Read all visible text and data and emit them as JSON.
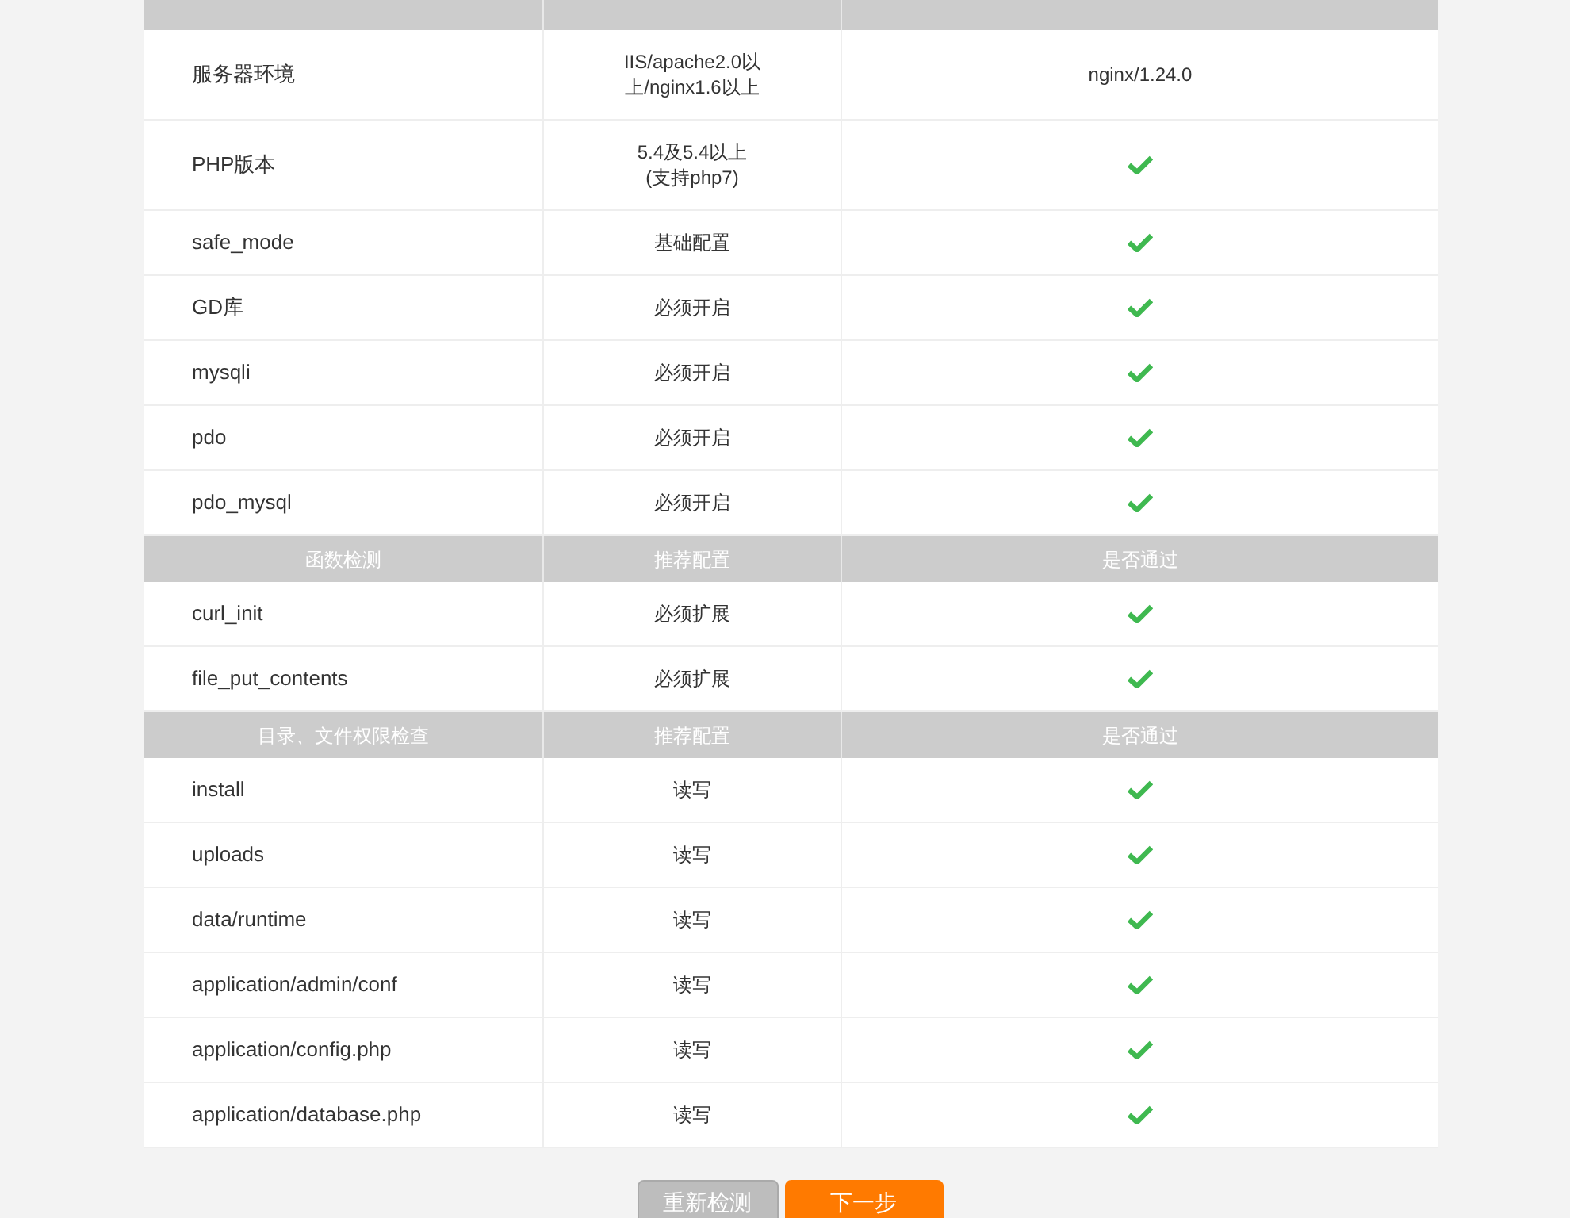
{
  "sections": [
    {
      "rows": [
        {
          "name": "服务器环境",
          "recommended": "IIS/apache2.0以上/nginx1.6以上",
          "status": {
            "kind": "text",
            "text": "nginx/1.24.0"
          }
        },
        {
          "name": "PHP版本",
          "recommended": "5.4及5.4以上\n(支持php7)",
          "status": {
            "kind": "check",
            "passed": true
          }
        },
        {
          "name": "safe_mode",
          "recommended": "基础配置",
          "status": {
            "kind": "check",
            "passed": true
          }
        },
        {
          "name": "GD库",
          "recommended": "必须开启",
          "status": {
            "kind": "check",
            "passed": true
          }
        },
        {
          "name": "mysqli",
          "recommended": "必须开启",
          "status": {
            "kind": "check",
            "passed": true
          }
        },
        {
          "name": "pdo",
          "recommended": "必须开启",
          "status": {
            "kind": "check",
            "passed": true
          }
        },
        {
          "name": "pdo_mysql",
          "recommended": "必须开启",
          "status": {
            "kind": "check",
            "passed": true
          }
        }
      ]
    },
    {
      "header": [
        "函数检测",
        "推荐配置",
        "是否通过"
      ],
      "rows": [
        {
          "name": "curl_init",
          "recommended": "必须扩展",
          "status": {
            "kind": "check",
            "passed": true
          }
        },
        {
          "name": "file_put_contents",
          "recommended": "必须扩展",
          "status": {
            "kind": "check",
            "passed": true
          }
        }
      ]
    },
    {
      "header": [
        "目录、文件权限检查",
        "推荐配置",
        "是否通过"
      ],
      "rows": [
        {
          "name": "install",
          "recommended": "读写",
          "status": {
            "kind": "check",
            "passed": true
          }
        },
        {
          "name": "uploads",
          "recommended": "读写",
          "status": {
            "kind": "check",
            "passed": true
          }
        },
        {
          "name": "data/runtime",
          "recommended": "读写",
          "status": {
            "kind": "check",
            "passed": true
          }
        },
        {
          "name": "application/admin/conf",
          "recommended": "读写",
          "status": {
            "kind": "check",
            "passed": true
          }
        },
        {
          "name": "application/config.php",
          "recommended": "读写",
          "status": {
            "kind": "check",
            "passed": true
          }
        },
        {
          "name": "application/database.php",
          "recommended": "读写",
          "status": {
            "kind": "check",
            "passed": true
          }
        }
      ]
    }
  ],
  "buttons": [
    {
      "label": "重新检测",
      "kind": "secondary"
    },
    {
      "label": "下一步",
      "kind": "primary"
    }
  ]
}
